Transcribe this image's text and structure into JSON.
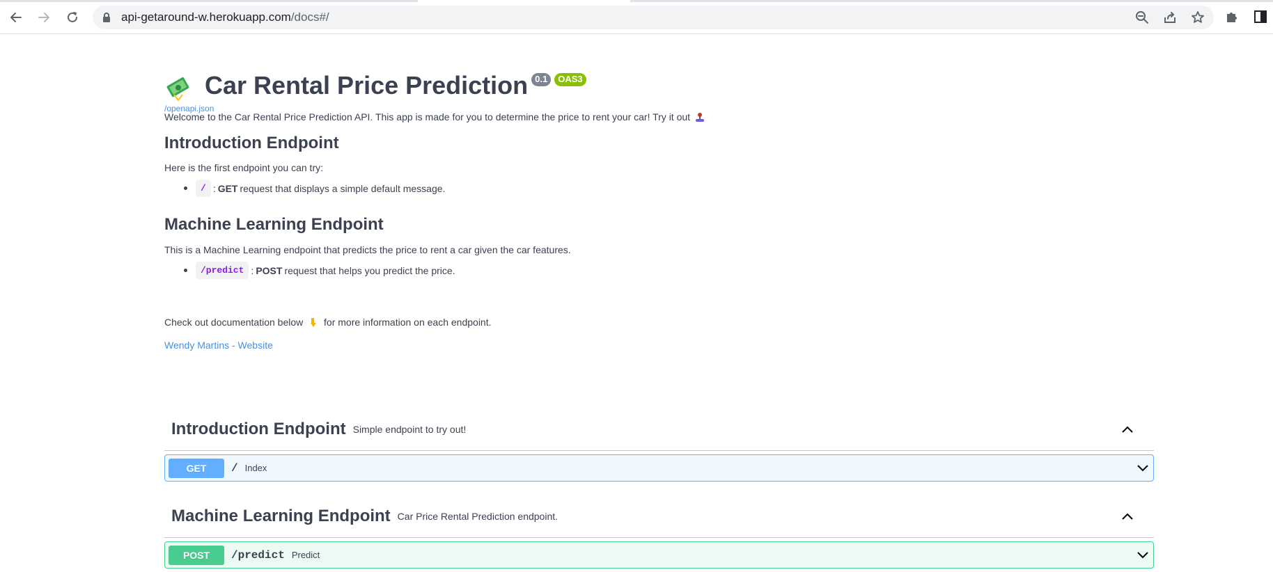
{
  "browser": {
    "url_host": "api-getaround-w.herokuapp.com",
    "url_path": "/docs#/"
  },
  "info": {
    "title": "Car Rental Price Prediction",
    "version": "0.1",
    "oas_badge": "OAS3",
    "openapi_link": "/openapi.json"
  },
  "description": {
    "welcome": "Welcome to the Car Rental Price Prediction API. This app is made for you to determine the price to rent your car! Try it out",
    "intro_heading": "Introduction Endpoint",
    "intro_text": "Here is the first endpoint you can try:",
    "intro_bullet": {
      "code": "/",
      "sep": ":",
      "method": "GET",
      "text": "request that displays a simple default message."
    },
    "ml_heading": "Machine Learning Endpoint",
    "ml_text": "This is a Machine Learning endpoint that predicts the price to rent a car given the car features.",
    "ml_bullet": {
      "code": "/predict",
      "sep": ":",
      "method": "POST",
      "text": "request that helps you predict the price."
    },
    "checkout_before": "Check out documentation below",
    "checkout_after": "for more information on each endpoint.",
    "author_link": "Wendy Martins - Website"
  },
  "tags": [
    {
      "name": "Introduction Endpoint",
      "description": "Simple endpoint to try out!",
      "operation": {
        "method": "GET",
        "path": "/",
        "summary": "Index"
      }
    },
    {
      "name": "Machine Learning Endpoint",
      "description": "Car Price Rental Prediction endpoint.",
      "operation": {
        "method": "POST",
        "path": "/predict",
        "summary": "Predict"
      }
    }
  ],
  "colors": {
    "get": "#61affe",
    "post": "#49cc90",
    "link": "#4990e2",
    "code": "#9012fe",
    "text": "#3b4151"
  },
  "icons": {
    "back": "arrow-left-icon",
    "forward": "arrow-right-icon",
    "reload": "reload-icon",
    "lock": "lock-icon",
    "zoom": "zoom-out-icon",
    "share": "share-icon",
    "bookmark": "star-icon",
    "extensions": "puzzle-icon",
    "sidepanel": "side-panel-icon",
    "title_emoji": "money-icon",
    "joystick": "joystick-icon",
    "pointing_down": "pointing-down-icon"
  }
}
